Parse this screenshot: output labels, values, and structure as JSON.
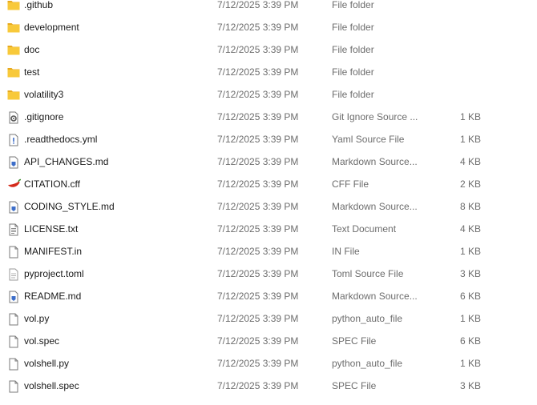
{
  "files": [
    {
      "name": ".github",
      "date": "7/12/2025 3:39 PM",
      "type": "File folder",
      "size": "",
      "icon": "folder-icon"
    },
    {
      "name": "development",
      "date": "7/12/2025 3:39 PM",
      "type": "File folder",
      "size": "",
      "icon": "folder-icon"
    },
    {
      "name": "doc",
      "date": "7/12/2025 3:39 PM",
      "type": "File folder",
      "size": "",
      "icon": "folder-icon"
    },
    {
      "name": "test",
      "date": "7/12/2025 3:39 PM",
      "type": "File folder",
      "size": "",
      "icon": "folder-icon"
    },
    {
      "name": "volatility3",
      "date": "7/12/2025 3:39 PM",
      "type": "File folder",
      "size": "",
      "icon": "folder-icon"
    },
    {
      "name": ".gitignore",
      "date": "7/12/2025 3:39 PM",
      "type": "Git Ignore Source ...",
      "size": "1 KB",
      "icon": "gear-file-icon"
    },
    {
      "name": ".readthedocs.yml",
      "date": "7/12/2025 3:39 PM",
      "type": "Yaml Source File",
      "size": "1 KB",
      "icon": "exclamation-file-icon"
    },
    {
      "name": "API_CHANGES.md",
      "date": "7/12/2025 3:39 PM",
      "type": "Markdown Source...",
      "size": "4 KB",
      "icon": "markdown-file-icon"
    },
    {
      "name": "CITATION.cff",
      "date": "7/12/2025 3:39 PM",
      "type": "CFF File",
      "size": "2 KB",
      "icon": "chili-icon"
    },
    {
      "name": "CODING_STYLE.md",
      "date": "7/12/2025 3:39 PM",
      "type": "Markdown Source...",
      "size": "8 KB",
      "icon": "markdown-file-icon"
    },
    {
      "name": "LICENSE.txt",
      "date": "7/12/2025 3:39 PM",
      "type": "Text Document",
      "size": "4 KB",
      "icon": "text-file-icon"
    },
    {
      "name": "MANIFEST.in",
      "date": "7/12/2025 3:39 PM",
      "type": "IN File",
      "size": "1 KB",
      "icon": "blank-file-icon"
    },
    {
      "name": "pyproject.toml",
      "date": "7/12/2025 3:39 PM",
      "type": "Toml Source File",
      "size": "3 KB",
      "icon": "code-file-icon"
    },
    {
      "name": "README.md",
      "date": "7/12/2025 3:39 PM",
      "type": "Markdown Source...",
      "size": "6 KB",
      "icon": "markdown-file-icon"
    },
    {
      "name": "vol.py",
      "date": "7/12/2025 3:39 PM",
      "type": "python_auto_file",
      "size": "1 KB",
      "icon": "blank-file-icon"
    },
    {
      "name": "vol.spec",
      "date": "7/12/2025 3:39 PM",
      "type": "SPEC File",
      "size": "6 KB",
      "icon": "blank-file-icon"
    },
    {
      "name": "volshell.py",
      "date": "7/12/2025 3:39 PM",
      "type": "python_auto_file",
      "size": "1 KB",
      "icon": "blank-file-icon"
    },
    {
      "name": "volshell.spec",
      "date": "7/12/2025 3:39 PM",
      "type": "SPEC File",
      "size": "3 KB",
      "icon": "blank-file-icon"
    }
  ],
  "colors": {
    "folder": "#f8c93a",
    "folder_tab": "#e7a91f",
    "chili": "#d42b1b",
    "markdown": "#3d6ec9",
    "secondary_text": "#6d6d6d"
  }
}
